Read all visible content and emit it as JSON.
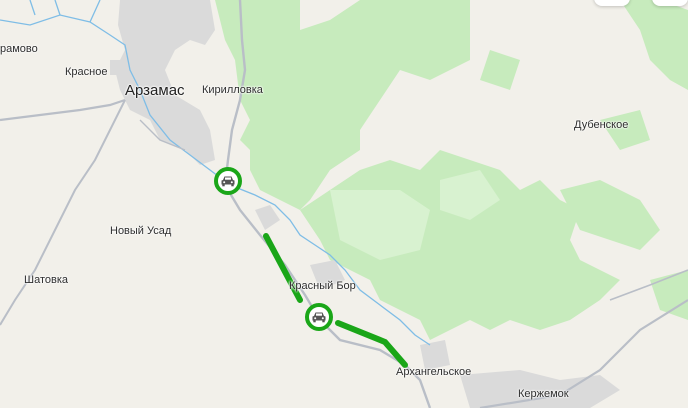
{
  "map": {
    "route_color": "#1aa618",
    "forest_color": "#c7ebbd",
    "urban_color": "#d9d9d9",
    "water_color": "#7fbde6",
    "labels": {
      "aramovo": "рамово",
      "krasnoe": "Красное",
      "arzamas": "Арзамас",
      "kirillovka": "Кирилловка",
      "dubenskoe": "Дубенское",
      "novy_usad": "Новый Усад",
      "shatovka": "Шатовка",
      "krasny_bor": "Красный Бор",
      "arkhangelskoe": "Архангельское",
      "kerzhemok": "Кержемок"
    },
    "markers": [
      {
        "icon": "car-icon"
      },
      {
        "icon": "car-icon"
      }
    ]
  }
}
